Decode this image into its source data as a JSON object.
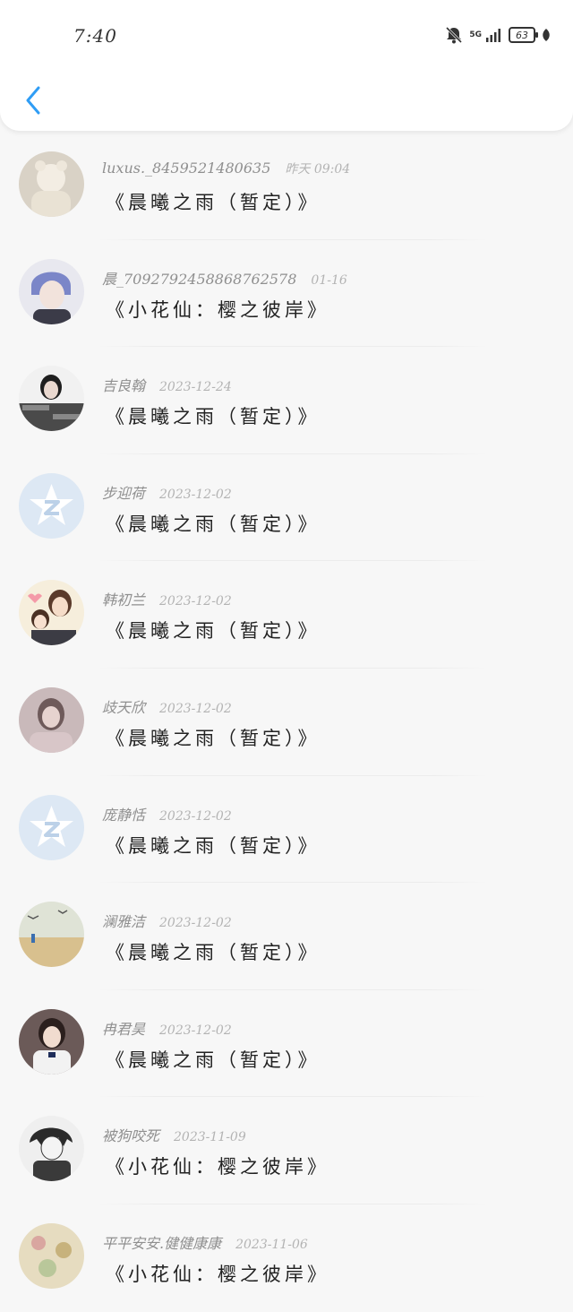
{
  "status_bar": {
    "time": "7:40",
    "network": "5G",
    "battery": "63"
  },
  "comments": [
    {
      "user": "luxus._8459521480635",
      "date": "昨天 09:04",
      "book": "《晨曦之雨（暂定）》"
    },
    {
      "user": "晨_7092792458868762578",
      "date": "01-16",
      "book": "《小花仙：樱之彼岸》"
    },
    {
      "user": "吉良翰",
      "date": "2023-12-24",
      "book": "《晨曦之雨（暂定）》"
    },
    {
      "user": "步迎荷",
      "date": "2023-12-02",
      "book": "《晨曦之雨（暂定）》"
    },
    {
      "user": "韩初兰",
      "date": "2023-12-02",
      "book": "《晨曦之雨（暂定）》"
    },
    {
      "user": "歧天欣",
      "date": "2023-12-02",
      "book": "《晨曦之雨（暂定）》"
    },
    {
      "user": "庞静恬",
      "date": "2023-12-02",
      "book": "《晨曦之雨（暂定）》"
    },
    {
      "user": "澜雅洁",
      "date": "2023-12-02",
      "book": "《晨曦之雨（暂定）》"
    },
    {
      "user": "冉君昊",
      "date": "2023-12-02",
      "book": "《晨曦之雨（暂定）》"
    },
    {
      "user": "被狗咬死",
      "date": "2023-11-09",
      "book": "《小花仙：樱之彼岸》"
    },
    {
      "user": "平平安安.健健康康",
      "date": "2023-11-06",
      "book": "《小花仙：樱之彼岸》"
    }
  ],
  "colors": {
    "accent": "#2f9df5",
    "username": "#8f8f8f",
    "date": "#b3b3b3",
    "title": "#222222"
  }
}
